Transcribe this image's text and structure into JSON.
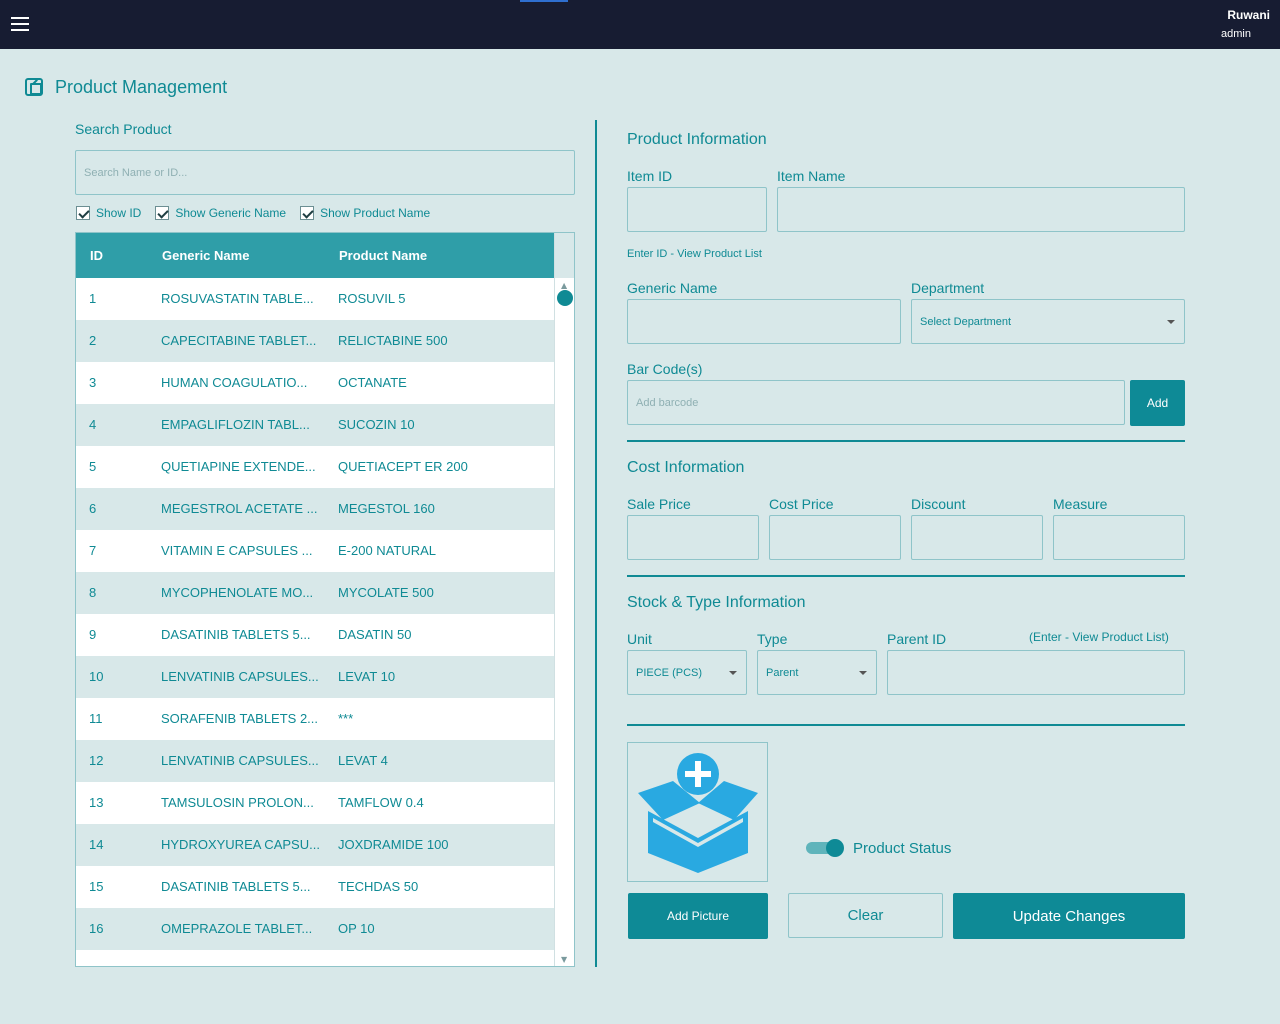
{
  "topbar": {
    "user_name": "Ruwani",
    "user_role": "admin"
  },
  "page": {
    "title": "Product Management"
  },
  "search": {
    "label": "Search Product",
    "placeholder": "Search Name or ID...",
    "checks": [
      "Show ID",
      "Show Generic Name",
      "Show Product Name"
    ]
  },
  "table": {
    "headers": {
      "id": "ID",
      "generic": "Generic Name",
      "product": "Product Name"
    },
    "rows": [
      {
        "id": "1",
        "generic": "ROSUVASTATIN TABLE...",
        "product": "ROSUVIL 5"
      },
      {
        "id": "2",
        "generic": "CAPECITABINE TABLET...",
        "product": "RELICTABINE 500"
      },
      {
        "id": "3",
        "generic": "HUMAN COAGULATIO...",
        "product": "OCTANATE"
      },
      {
        "id": "4",
        "generic": "EMPAGLIFLOZIN TABL...",
        "product": "SUCOZIN 10"
      },
      {
        "id": "5",
        "generic": "QUETIAPINE EXTENDE...",
        "product": "QUETIACEPT  ER 200"
      },
      {
        "id": "6",
        "generic": "MEGESTROL ACETATE ...",
        "product": "MEGESTOL 160"
      },
      {
        "id": "7",
        "generic": "VITAMIN E CAPSULES ...",
        "product": "E-200 NATURAL"
      },
      {
        "id": "8",
        "generic": "MYCOPHENOLATE MO...",
        "product": "MYCOLATE 500"
      },
      {
        "id": "9",
        "generic": "DASATINIB TABLETS 5...",
        "product": "DASATIN 50"
      },
      {
        "id": "10",
        "generic": "LENVATINIB CAPSULES...",
        "product": "LEVAT 10"
      },
      {
        "id": "11",
        "generic": "SORAFENIB TABLETS 2...",
        "product": "***"
      },
      {
        "id": "12",
        "generic": "LENVATINIB CAPSULES...",
        "product": "LEVAT 4"
      },
      {
        "id": "13",
        "generic": "TAMSULOSIN PROLON...",
        "product": "TAMFLOW 0.4"
      },
      {
        "id": "14",
        "generic": "HYDROXYUREA CAPSU...",
        "product": "JOXDRAMIDE 100"
      },
      {
        "id": "15",
        "generic": "DASATINIB TABLETS 5...",
        "product": "TECHDAS 50"
      },
      {
        "id": "16",
        "generic": "OMEPRAZOLE TABLET...",
        "product": "OP 10"
      }
    ]
  },
  "product_info": {
    "title": "Product Information",
    "item_id_label": "Item ID",
    "item_name_label": "Item Name",
    "hint": "Enter ID - View Product List",
    "generic_label": "Generic Name",
    "department_label": "Department",
    "department_value": "Select Department",
    "barcode_label": "Bar Code(s)",
    "barcode_placeholder": "Add barcode",
    "add_label": "Add"
  },
  "cost_info": {
    "title": "Cost Information",
    "sale_price_label": "Sale Price",
    "cost_price_label": "Cost Price",
    "discount_label": "Discount",
    "measure_label": "Measure"
  },
  "stock_info": {
    "title": "Stock & Type Information",
    "unit_label": "Unit",
    "unit_value": "PIECE (PCS)",
    "type_label": "Type",
    "type_value": "Parent",
    "parent_label": "Parent ID",
    "parent_hint": "(Enter - View Product List)"
  },
  "actions": {
    "product_status_label": "Product Status",
    "add_picture_label": "Add Picture",
    "clear_label": "Clear",
    "update_label": "Update Changes"
  },
  "colors": {
    "accent": "#0e8a96",
    "topbar": "#171c32",
    "background": "#d8e8e9",
    "picture_icon": "#29a9e1"
  },
  "icons": {
    "menu": "hamburger-icon",
    "page": "external-link-icon",
    "picture": "box-plus-icon"
  }
}
